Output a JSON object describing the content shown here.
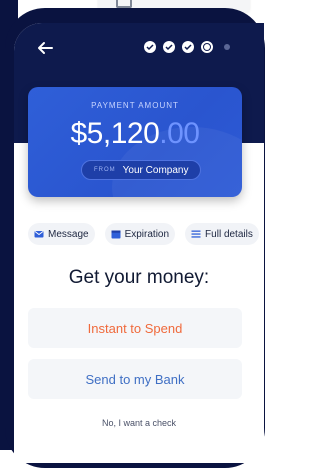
{
  "header": {
    "back_icon": "arrow-left-icon",
    "steps": [
      {
        "state": "done"
      },
      {
        "state": "done"
      },
      {
        "state": "done"
      },
      {
        "state": "current"
      },
      {
        "state": "future"
      }
    ]
  },
  "payment": {
    "label": "PAYMENT AMOUNT",
    "amount_main": "$5,120",
    "amount_cents": ".00",
    "from_label": "FROM",
    "from_value": "Your Company"
  },
  "chips": [
    {
      "label": "Message",
      "icon": "envelope-icon"
    },
    {
      "label": "Expiration",
      "icon": "calendar-icon"
    },
    {
      "label": "Full details",
      "icon": "list-icon"
    }
  ],
  "main": {
    "title": "Get your money:",
    "option_instant": "Instant to Spend",
    "option_bank": "Send to my Bank",
    "check_link": "No, I want a check"
  },
  "colors": {
    "navy": "#0e1a4d",
    "card_blue": "#2f5fd8",
    "instant_orange": "#f06a3c",
    "bank_blue": "#3f6fc4"
  }
}
